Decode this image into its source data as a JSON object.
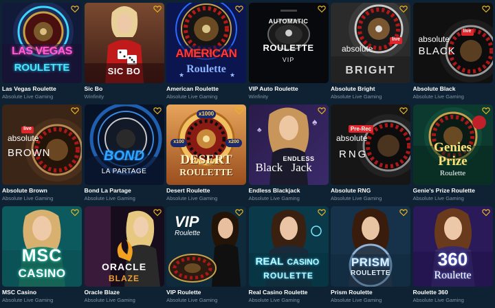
{
  "games": [
    {
      "title": "Las Vegas Roulette",
      "provider": "Absolute Live Gaming",
      "art": [
        "LAS VEGAS",
        "ROULETTE"
      ]
    },
    {
      "title": "Sic Bo",
      "provider": "Winfinity",
      "art": [
        "SIC BO"
      ]
    },
    {
      "title": "American Roulette",
      "provider": "Absolute Live Gaming",
      "art": [
        "AMERICAN",
        "Roulette"
      ]
    },
    {
      "title": "VIP Auto Roulette",
      "provider": "Winfinity",
      "art": [
        "AUTOMATIC",
        "ROULETTE",
        "VIP"
      ]
    },
    {
      "title": "Absolute Bright",
      "provider": "Absolute Live Gaming",
      "art": [
        "live",
        "absolute",
        "BRIGHT"
      ]
    },
    {
      "title": "Absolute Black",
      "provider": "Absolute Live Gaming",
      "art": [
        "live",
        "absolute",
        "BLACK"
      ]
    },
    {
      "title": "Absolute Brown",
      "provider": "Absolute Live Gaming",
      "art": [
        "live",
        "absolute",
        "BROWN"
      ]
    },
    {
      "title": "Bond La Partage",
      "provider": "Absolute Live Gaming",
      "art": [
        "BOND",
        "LA PARTAGE"
      ]
    },
    {
      "title": "Desert Roulette",
      "provider": "Absolute Live Gaming",
      "art": [
        "DESERT",
        "ROULETTE",
        "x1000",
        "x100",
        "x200"
      ]
    },
    {
      "title": "Endless Blackjack",
      "provider": "Absolute Live Gaming",
      "art": [
        "ENDLESS",
        "Black",
        "Jack"
      ]
    },
    {
      "title": "Absolute RNG",
      "provider": "Absolute Live Gaming",
      "art": [
        "Pre-Rec",
        "absolute",
        "RNG"
      ]
    },
    {
      "title": "Genie's Prize Roulette",
      "provider": "Absolute Live Gaming",
      "art": [
        "Genies",
        "Prize",
        "Roulette"
      ]
    },
    {
      "title": "MSC Casino",
      "provider": "Absolute Live Gaming",
      "art": [
        "MSC",
        "CASINO"
      ]
    },
    {
      "title": "Oracle Blaze",
      "provider": "Absolute Live Gaming",
      "art": [
        "ORACLE",
        "BLAZE"
      ]
    },
    {
      "title": "VIP Roulette",
      "provider": "Absolute Live Gaming",
      "art": [
        "VIP",
        "Roulette"
      ]
    },
    {
      "title": "Real Casino Roulette",
      "provider": "Absolute Live Gaming",
      "art": [
        "REAL",
        "CASINO",
        "ROULETTE"
      ]
    },
    {
      "title": "Prism Roulette",
      "provider": "Absolute Live Gaming",
      "art": [
        "PRISM",
        "ROULETTE"
      ]
    },
    {
      "title": "Roulette 360",
      "provider": "Absolute Live Gaming",
      "art": [
        "360",
        "Roulette"
      ]
    }
  ],
  "icons": {
    "favorite": "heart-outline-icon"
  },
  "colors": {
    "background": "#0e2233",
    "favorite": "#e6b422",
    "provider_text": "#7f93a6"
  }
}
